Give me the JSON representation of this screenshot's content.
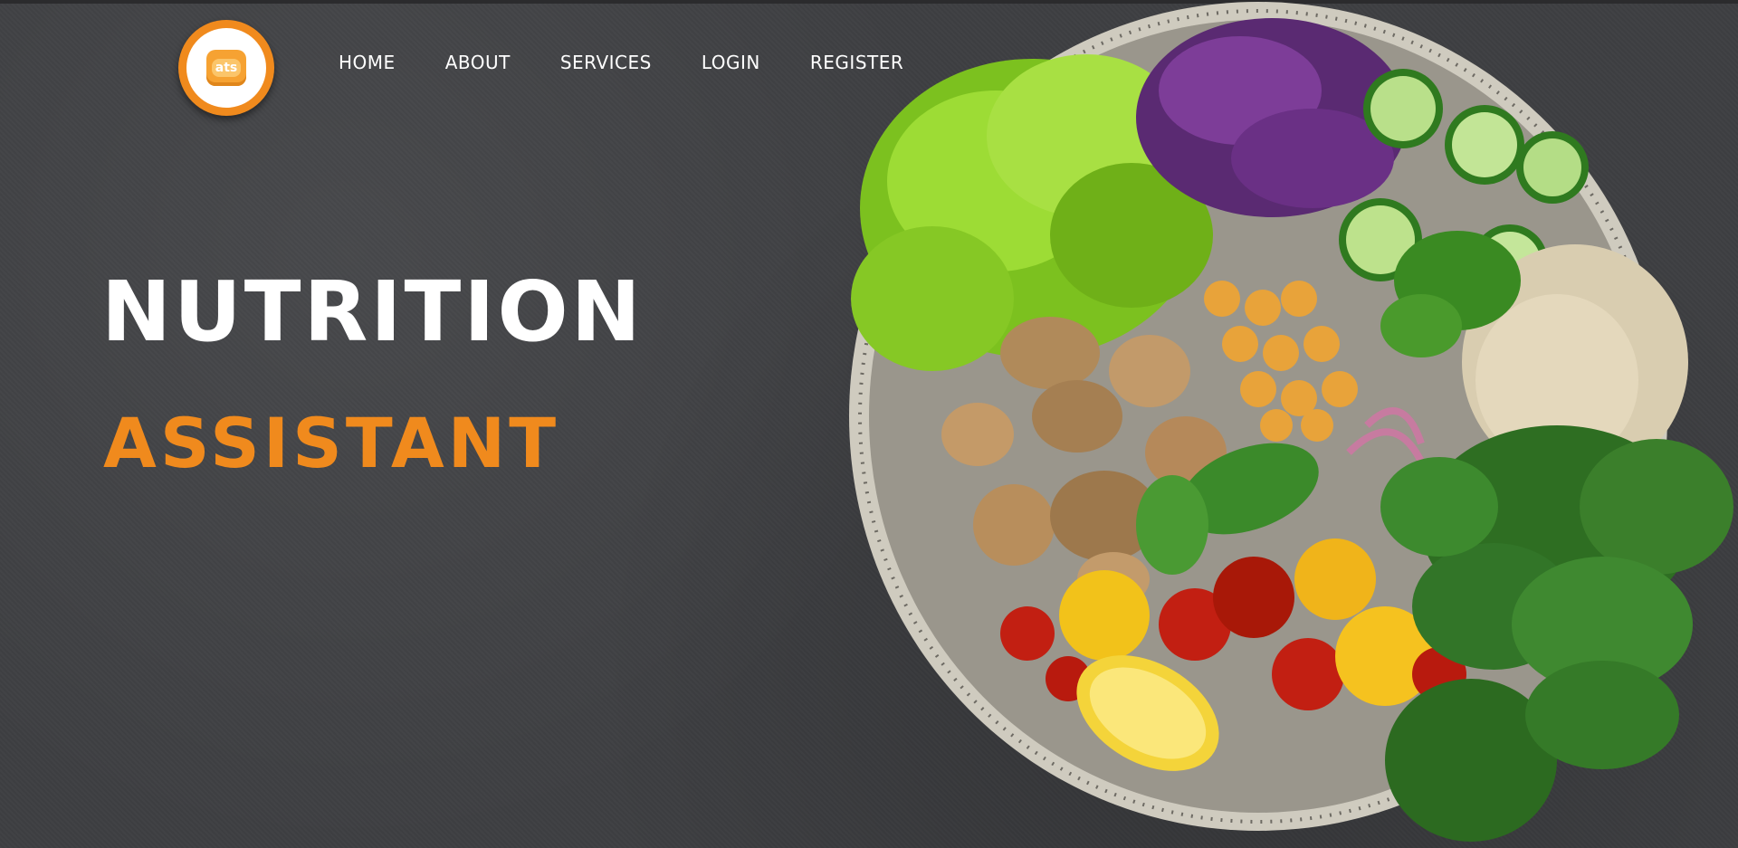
{
  "logo": {
    "text": "ats",
    "icon": "logo-badge-icon"
  },
  "nav": {
    "items": [
      "HOME",
      "ABOUT",
      "SERVICES",
      "LOGIN",
      "REGISTER"
    ]
  },
  "hero": {
    "title": "NUTRITION",
    "subtitle": "ASSISTANT"
  },
  "colors": {
    "accent": "#f08a1d",
    "background": "#3e3f42",
    "text": "#ffffff"
  },
  "image": {
    "icon": "food-bowl-illustration"
  }
}
